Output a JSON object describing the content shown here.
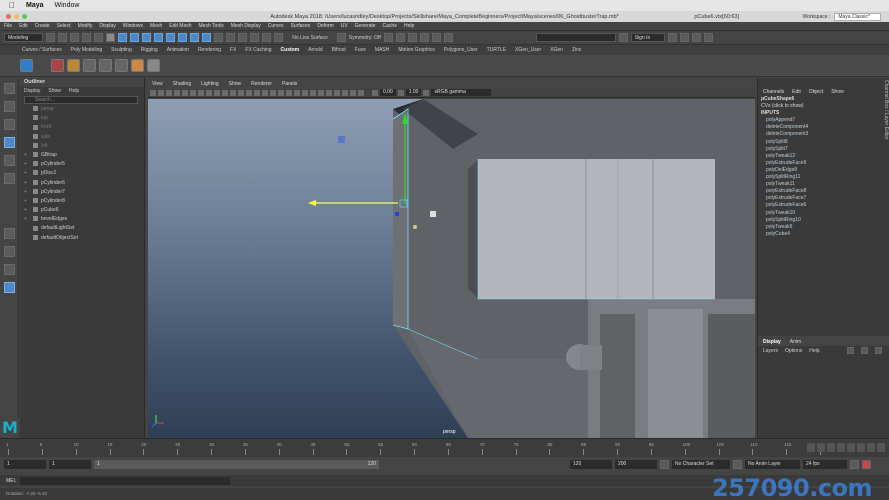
{
  "mac_menu": {
    "app": "Maya",
    "window": "Window"
  },
  "title": "Autodesk Maya 2018: /Users/lucasridley/Desktop/Projects/Skillshare/Maya_CompleteBeginners/Project/Maya/scenes/06_GhostbusterTrap.mb*",
  "selection_readout": "pCube6.vtx[60:63]",
  "workspace": {
    "label": "Workspace :",
    "value": "Maya Classic*"
  },
  "menu_items": [
    "File",
    "Edit",
    "Create",
    "Select",
    "Modify",
    "Display",
    "Windows",
    "Mesh",
    "Edit Mesh",
    "Mesh Tools",
    "Mesh Display",
    "Curves",
    "Surfaces",
    "Deform",
    "UV",
    "Generate",
    "Cache",
    "Help"
  ],
  "status_line": {
    "mode": "Modeling",
    "live": "No Live Surface",
    "symmetry": "Symmetry: Off",
    "sign_in": "Sign In"
  },
  "shelf_tabs": [
    "Curves / Surfaces",
    "Poly Modeling",
    "Sculpting",
    "Rigging",
    "Animation",
    "Rendering",
    "FX",
    "FX Caching",
    "Custom",
    "Arnold",
    "Bifrost",
    "Fuze",
    "MASH",
    "Motion Graphics",
    "Polygons_User",
    "TURTLE",
    "XGen_User",
    "XGen",
    "Zinc"
  ],
  "shelf_active": "Custom",
  "outliner": {
    "title": "Outliner",
    "menus": [
      "Display",
      "Show",
      "Help"
    ],
    "search_placeholder": "Search...",
    "items": [
      {
        "label": "persp",
        "dim": true,
        "plus": false
      },
      {
        "label": "top",
        "dim": true,
        "plus": false
      },
      {
        "label": "front",
        "dim": true,
        "plus": false
      },
      {
        "label": "side",
        "dim": true,
        "plus": false
      },
      {
        "label": "left",
        "dim": true,
        "plus": false
      },
      {
        "label": "GBtrap",
        "dim": false,
        "plus": true
      },
      {
        "label": "pCylinder5",
        "dim": false,
        "plus": true
      },
      {
        "label": "pDisc2",
        "dim": false,
        "plus": true
      },
      {
        "label": "pCylinder6",
        "dim": false,
        "plus": true
      },
      {
        "label": "pCylinder7",
        "dim": false,
        "plus": true
      },
      {
        "label": "pCylinder8",
        "dim": false,
        "plus": true
      },
      {
        "label": "pCube6",
        "dim": false,
        "plus": true
      },
      {
        "label": "bevelEdges",
        "dim": false,
        "plus": true
      },
      {
        "label": "defaultLightSet",
        "dim": false,
        "plus": false
      },
      {
        "label": "defaultObjectSet",
        "dim": false,
        "plus": false
      }
    ]
  },
  "panel": {
    "menus": [
      "View",
      "Shading",
      "Lighting",
      "Show",
      "Renderer",
      "Panels"
    ],
    "exposure": "0.00",
    "gamma": "1.00",
    "color_space": "sRGB gamma",
    "camera_label": "persp"
  },
  "channel_box": {
    "menus": [
      "Channels",
      "Edit",
      "Object",
      "Show"
    ],
    "shape": "pCubeShape6",
    "cvs": "CVs (click to show)",
    "inputs_label": "INPUTS",
    "inputs": [
      "polyAppend7",
      "deleteComponent4",
      "deleteComponent3",
      "polySplit8",
      "polySplit7",
      "polyTweak12",
      "polyExtrudeFace9",
      "polyDelEdge8",
      "polySplitRing11",
      "polyTweak11",
      "polyExtrudeFace8",
      "polyExtrudeFace7",
      "polyExtrudeFace6",
      "polyTweak10",
      "polySplitRing10",
      "polyTweak9",
      "polyCube4"
    ]
  },
  "layer_editor": {
    "tabs": [
      "Display",
      "Anim"
    ],
    "active_tab": "Display",
    "menus": [
      "Layers",
      "Options",
      "Help"
    ]
  },
  "side_tabs": "Channel Box / Layer Editor",
  "time_slider": {
    "ticks": [
      "1",
      "5",
      "10",
      "15",
      "20",
      "25",
      "30",
      "35",
      "40",
      "45",
      "50",
      "55",
      "60",
      "65",
      "70",
      "75",
      "80",
      "85",
      "90",
      "95",
      "100",
      "105",
      "110",
      "115",
      "1"
    ]
  },
  "range": {
    "start": "1",
    "current": "1",
    "inner_start": "1",
    "inner_end": "120",
    "end": "120",
    "max": "200",
    "char_set": "No Character Set",
    "anim_layer": "No Anim Layer",
    "fps": "24 fps"
  },
  "mel": {
    "label": "MEL"
  },
  "help_line": "Rotation:  -7.20    -5.40",
  "watermark": "257090.com",
  "maya_logo": "M"
}
